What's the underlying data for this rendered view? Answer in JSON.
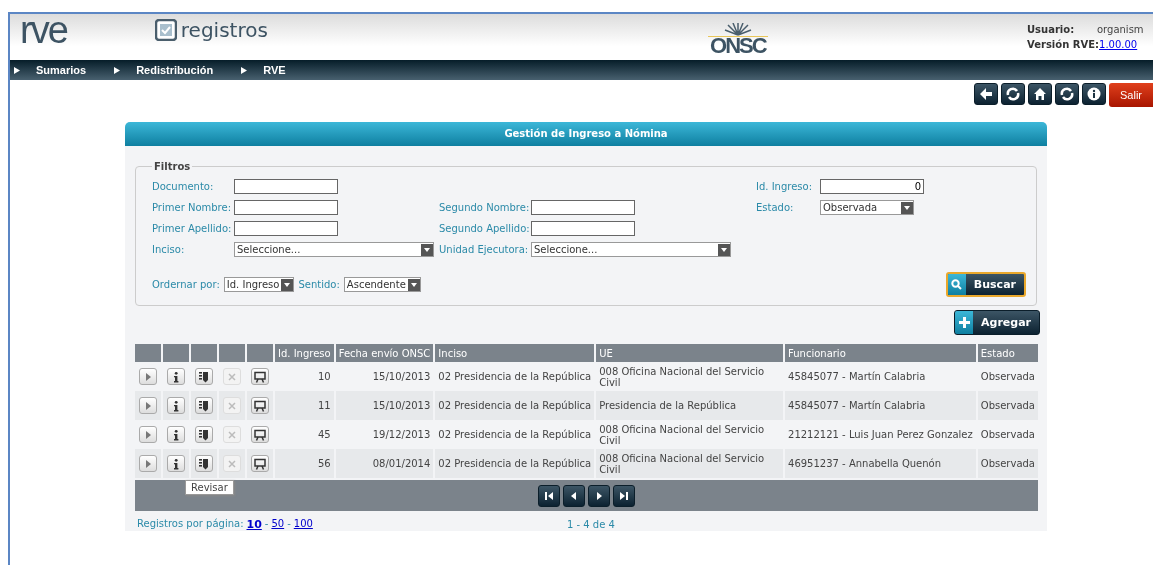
{
  "header": {
    "logo": "rve",
    "app_name": "registros",
    "org_logo": "ONSC",
    "user_label": "Usuario:",
    "user_value": "organism",
    "version_label": "Versión RVE:",
    "version_value": "1.00.00"
  },
  "nav": [
    "Sumarios",
    "Redistribución",
    "RVE"
  ],
  "toolbar": [
    {
      "kind": "back"
    },
    {
      "kind": "refresh"
    },
    {
      "kind": "home"
    },
    {
      "kind": "refresh"
    },
    {
      "kind": "info"
    },
    {
      "kind": "exit",
      "label": "Salir"
    }
  ],
  "panel": {
    "title": "Gestión de Ingreso a Nómina"
  },
  "filters": {
    "legend": "Filtros",
    "rows": [
      {
        "left": {
          "label": "Documento:",
          "kind": "text"
        },
        "right": {
          "label": "Id. Ingreso:",
          "kind": "text",
          "value": "0"
        }
      },
      {
        "left": {
          "label": "Primer Nombre:",
          "kind": "text"
        },
        "middle": {
          "label": "Segundo Nombre:",
          "kind": "text"
        },
        "right": {
          "label": "Estado:",
          "kind": "select",
          "value": "Observada"
        }
      },
      {
        "left": {
          "label": "Primer Apellido:",
          "kind": "text"
        },
        "middle": {
          "label": "Segundo Apellido:",
          "kind": "text"
        }
      },
      {
        "left": {
          "label": "Inciso:",
          "kind": "wide-select",
          "value": "Seleccione..."
        },
        "middle": {
          "label": "Unidad Ejecutora:",
          "kind": "wide-select",
          "value": "Seleccione..."
        }
      }
    ],
    "sort": [
      {
        "label": "Ordernar por:",
        "value": "Id. Ingreso"
      },
      {
        "label": "Sentido:",
        "value": "Ascendente"
      }
    ],
    "search_button": "Buscar"
  },
  "add_button": "Agregar",
  "table": {
    "columns": [
      "Id. Ingreso",
      "Fecha envío ONSC",
      "Inciso",
      "UE",
      "Funcionario",
      "Estado"
    ],
    "rows": [
      {
        "actions": [
          {
            "kind": "play",
            "disabled": false
          },
          {
            "kind": "info",
            "disabled": false
          },
          {
            "kind": "review",
            "disabled": false
          },
          {
            "kind": "delete",
            "disabled": true
          },
          {
            "kind": "present",
            "disabled": false
          }
        ],
        "cells": [
          "10",
          "15/10/2013",
          "02 Presidencia de la República",
          "008 Oficina Nacional del Servicio Civil",
          "45845077 - Martín Calabria",
          "Observada"
        ]
      },
      {
        "actions": [
          {
            "kind": "play",
            "disabled": false
          },
          {
            "kind": "info",
            "disabled": false
          },
          {
            "kind": "review",
            "disabled": false
          },
          {
            "kind": "delete",
            "disabled": true
          },
          {
            "kind": "present",
            "disabled": false
          }
        ],
        "cells": [
          "11",
          "15/10/2013",
          "02 Presidencia de la República",
          "Presidencia de la República",
          "45845077 - Martín Calabria",
          "Observada"
        ]
      },
      {
        "actions": [
          {
            "kind": "play",
            "disabled": false
          },
          {
            "kind": "info",
            "disabled": false
          },
          {
            "kind": "review",
            "disabled": false
          },
          {
            "kind": "delete",
            "disabled": true
          },
          {
            "kind": "present",
            "disabled": false
          }
        ],
        "cells": [
          "45",
          "19/12/2013",
          "02 Presidencia de la República",
          "008 Oficina Nacional del Servicio Civil",
          "21212121 - Luis Juan Perez Gonzalez",
          "Observada"
        ]
      },
      {
        "actions": [
          {
            "kind": "play",
            "disabled": false
          },
          {
            "kind": "info",
            "disabled": false
          },
          {
            "kind": "review",
            "disabled": false,
            "tooltip": "Revisar"
          },
          {
            "kind": "delete",
            "disabled": true
          },
          {
            "kind": "present",
            "disabled": false
          }
        ],
        "cells": [
          "56",
          "08/01/2014",
          "02 Presidencia de la República",
          "008 Oficina Nacional del Servicio Civil",
          "46951237 - Annabella Quenón",
          "Observada"
        ]
      }
    ],
    "pager": [
      {
        "kind": "first"
      },
      {
        "kind": "prev"
      },
      {
        "kind": "next"
      },
      {
        "kind": "last"
      }
    ]
  },
  "footer": {
    "per_page_label": "Registros por página:",
    "per_page": [
      {
        "label": "10",
        "selected": true
      },
      {
        "label": "50",
        "selected": false
      },
      {
        "label": "100",
        "selected": false
      }
    ],
    "separator": "-",
    "range": "1 - 4 de 4"
  }
}
